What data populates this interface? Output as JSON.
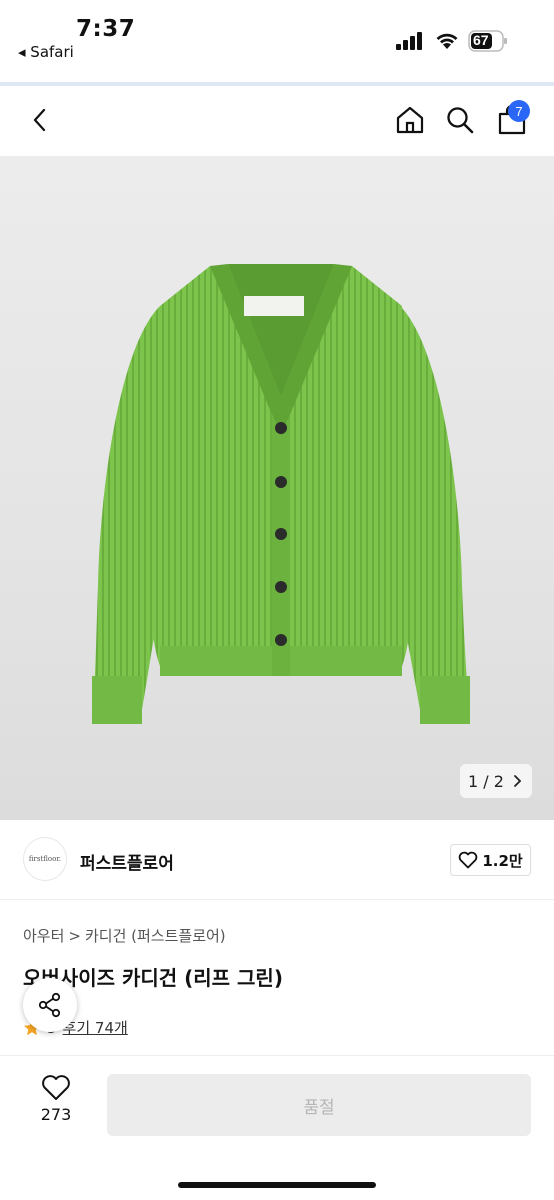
{
  "status_bar": {
    "time": "7:37",
    "back_app": "◂ Safari",
    "battery": "67"
  },
  "navbar": {
    "cart_count": "7"
  },
  "product_image": {
    "pager": "1 / 2"
  },
  "brand": {
    "logo_text": "firstfloor.",
    "name": "퍼스트플로어",
    "likes": "1.2만"
  },
  "breadcrumb": {
    "category": "아우터",
    "separator": ">",
    "subcategory": "카디건 (퍼스트플로어)"
  },
  "product": {
    "title": "오버사이즈 카디건 (리프 그린)",
    "rating": "5",
    "reviews": "후기 74개"
  },
  "bottom_bar": {
    "wish_count": "273",
    "buy_label": "품절"
  },
  "colors": {
    "accent": "#2b67f6",
    "sweater": "#7cc44c",
    "disabled_button": "#ececec"
  }
}
